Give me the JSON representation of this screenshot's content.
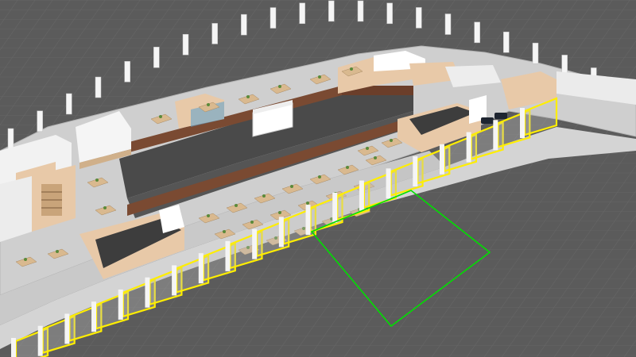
{
  "scene": {
    "kind": "3d-floorplan-viewport",
    "colors": {
      "background": "#5b5b5b",
      "grid_line": "#6a6a6a",
      "floor": "#cfcfcf",
      "wall_light": "#f2f2f2",
      "wall_beige": "#e8c9a8",
      "wall_brown": "#7a4a32",
      "dark_roof": "#3d3d3d",
      "selection_yellow": "#ffee00",
      "selection_green": "#00e000",
      "desk": "#d9b98f"
    },
    "icons": [
      "potted-plant-icon",
      "desk-cluster-icon",
      "bookshelf-icon",
      "car-icon"
    ]
  }
}
